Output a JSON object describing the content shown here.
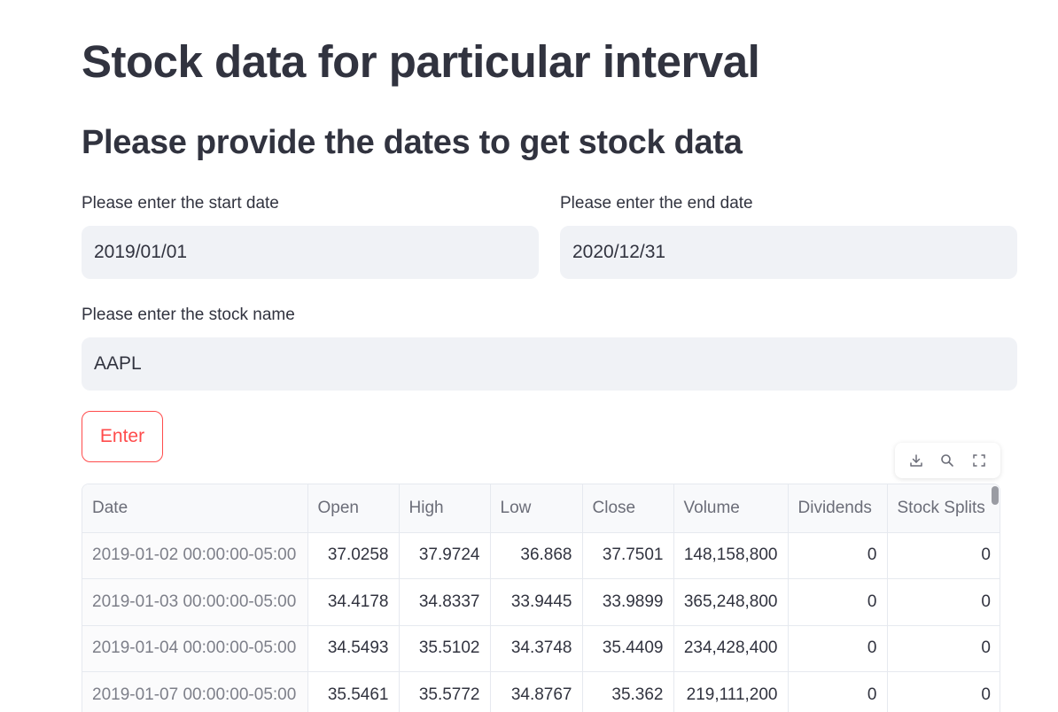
{
  "page": {
    "title": "Stock data for particular interval",
    "subtitle": "Please provide the dates to get stock data"
  },
  "form": {
    "start_date_label": "Please enter the start date",
    "start_date_value": "2019/01/01",
    "end_date_label": "Please enter the end date",
    "end_date_value": "2020/12/31",
    "stock_label": "Please enter the stock name",
    "stock_value": "AAPL",
    "enter_label": "Enter"
  },
  "toolbar": {
    "icons": [
      "download-icon",
      "search-icon",
      "fullscreen-icon"
    ]
  },
  "colors": {
    "accent": "#ff4b4b",
    "input_bg": "#f0f2f6",
    "text": "#31333f"
  },
  "table": {
    "columns": [
      "Date",
      "Open",
      "High",
      "Low",
      "Close",
      "Volume",
      "Dividends",
      "Stock Splits"
    ],
    "rows": [
      [
        "2019-01-02 00:00:00-05:00",
        "37.0258",
        "37.9724",
        "36.868",
        "37.7501",
        "148,158,800",
        "0",
        "0"
      ],
      [
        "2019-01-03 00:00:00-05:00",
        "34.4178",
        "34.8337",
        "33.9445",
        "33.9899",
        "365,248,800",
        "0",
        "0"
      ],
      [
        "2019-01-04 00:00:00-05:00",
        "34.5493",
        "35.5102",
        "34.3748",
        "35.4409",
        "234,428,400",
        "0",
        "0"
      ],
      [
        "2019-01-07 00:00:00-05:00",
        "35.5461",
        "35.5772",
        "34.8767",
        "35.362",
        "219,111,200",
        "0",
        "0"
      ]
    ]
  }
}
